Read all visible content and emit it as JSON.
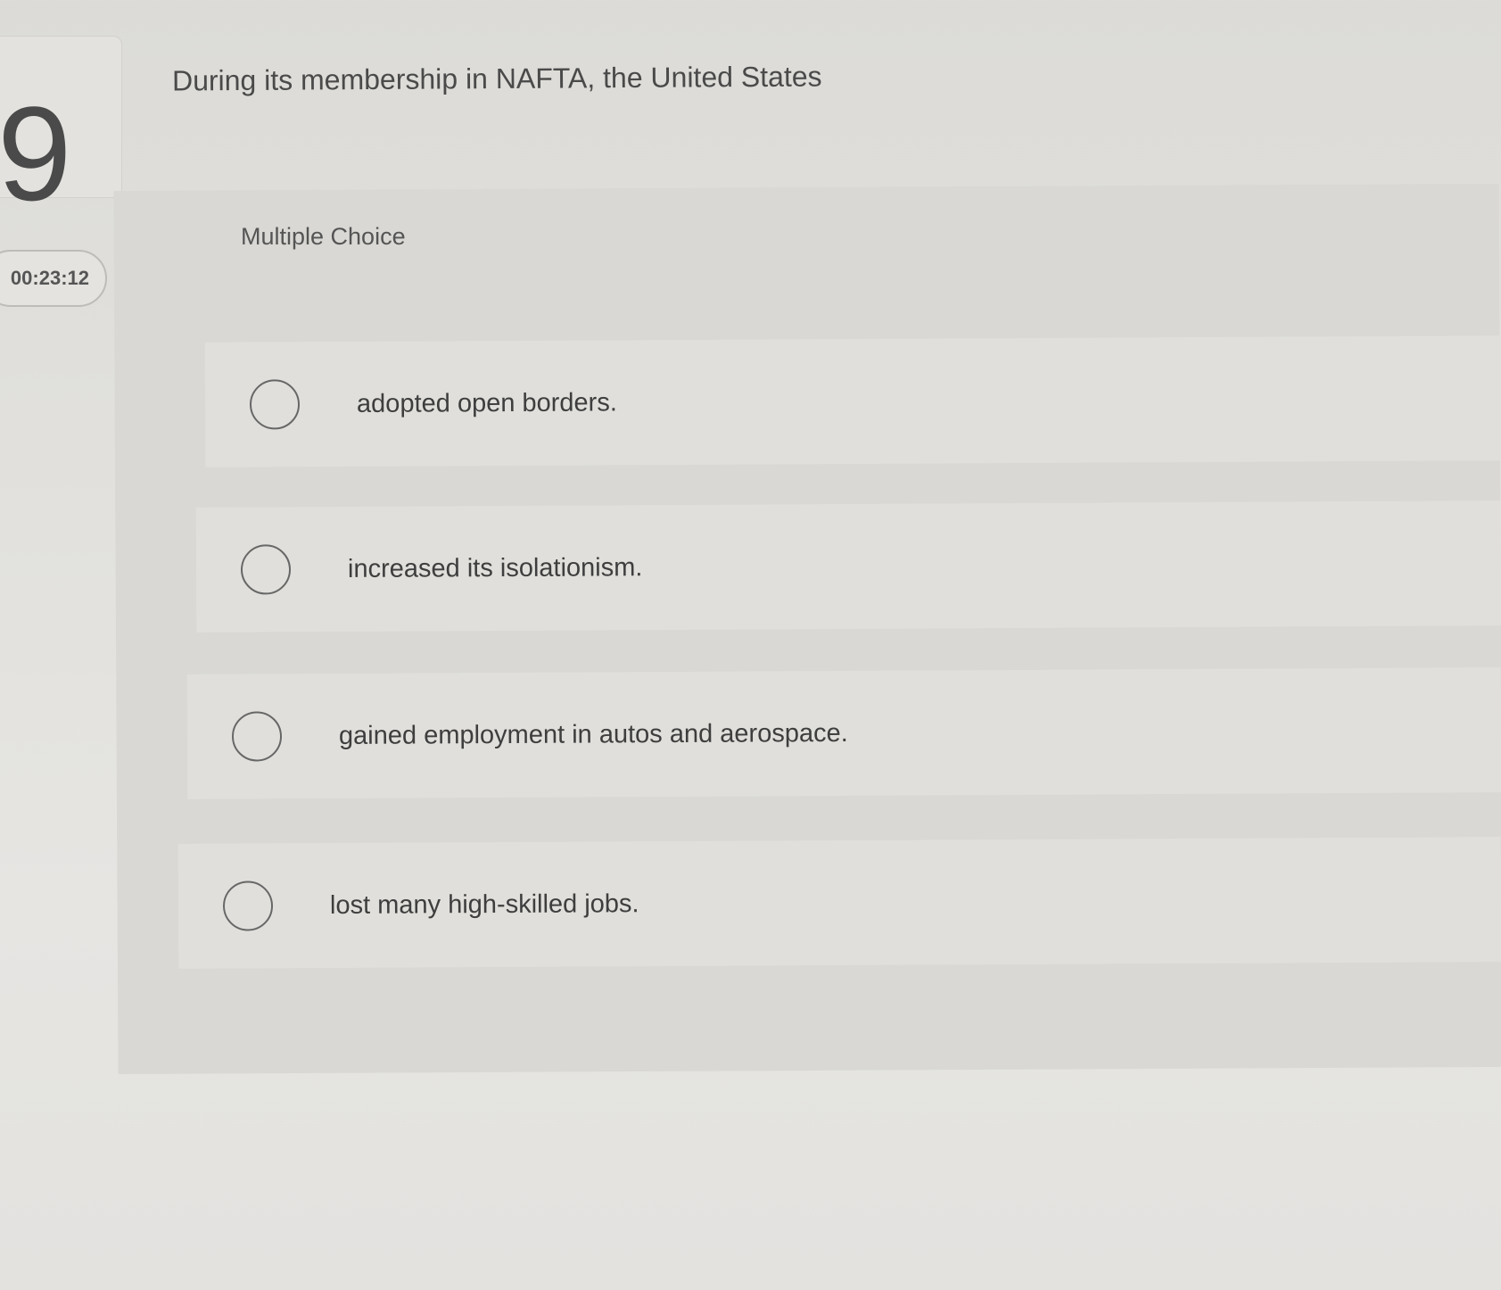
{
  "question": {
    "number": "9",
    "text": "During its membership in NAFTA, the United States",
    "timer": "00:23:12",
    "type_label": "Multiple Choice"
  },
  "options": [
    {
      "label": "adopted open borders."
    },
    {
      "label": "increased its isolationism."
    },
    {
      "label": "gained employment in autos and aerospace."
    },
    {
      "label": "lost many high-skilled jobs."
    }
  ]
}
